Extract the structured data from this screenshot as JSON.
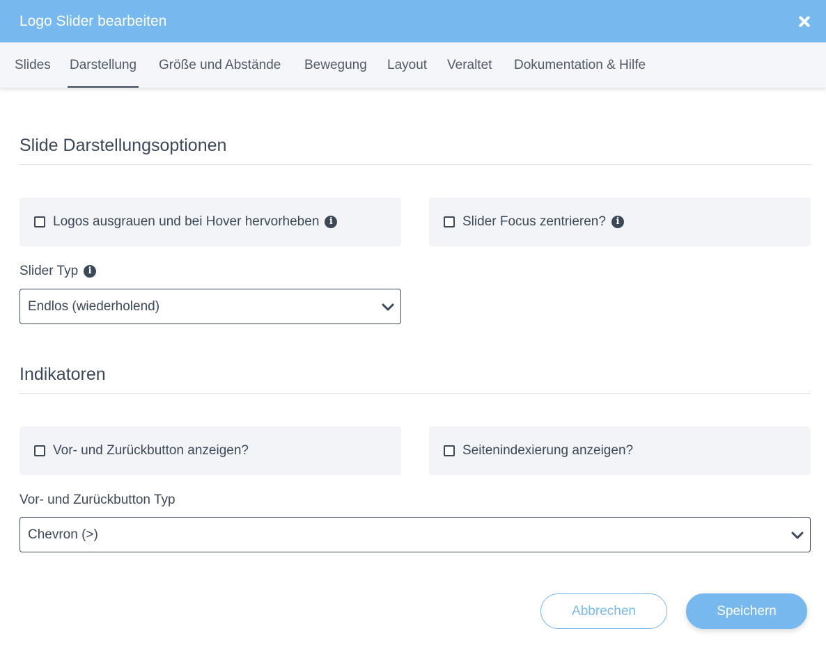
{
  "window": {
    "title": "Logo Slider bearbeiten",
    "close_icon": "close-icon"
  },
  "tabs": [
    {
      "label": "Slides"
    },
    {
      "label": "Darstellung",
      "active": true
    },
    {
      "label": "Größe und Abstände"
    },
    {
      "label": "Bewegung"
    },
    {
      "label": "Layout"
    },
    {
      "label": "Veraltet"
    },
    {
      "label": "Dokumentation & Hilfe"
    }
  ],
  "display_section": {
    "title": "Slide Darstellungsoptionen",
    "options": [
      {
        "label": "Logos ausgrauen und bei Hover hervorheben",
        "checked": false,
        "has_info": true
      },
      {
        "label": "Slider Focus zentrieren?",
        "checked": false,
        "has_info": true
      }
    ],
    "slider_type": {
      "label": "Slider Typ",
      "value": "Endlos (wiederholend)"
    }
  },
  "indicators_section": {
    "title": "Indikatoren",
    "options": [
      {
        "label": "Vor- und Zurückbutton anzeigen?",
        "checked": false
      },
      {
        "label": "Seitenindexierung anzeigen?",
        "checked": false
      }
    ],
    "button_type": {
      "label": "Vor- und Zurückbutton Typ",
      "value": "Chevron (>)"
    }
  },
  "footer": {
    "cancel_label": "Abbrechen",
    "save_label": "Speichern"
  },
  "colors": {
    "accent": "#77b9ef",
    "text": "#3c4858",
    "panel": "#f3f4f8"
  }
}
